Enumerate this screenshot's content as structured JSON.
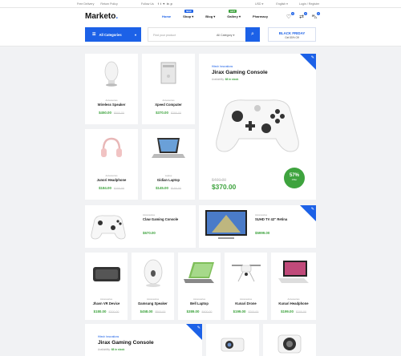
{
  "topbar": {
    "free_delivery": "Free Delivery",
    "return_policy": "Return Policy",
    "follow_us": "Follow Us",
    "social": [
      "f",
      "t",
      "✦",
      "in",
      "p"
    ],
    "currency": "USD ▾",
    "language": "English ▾",
    "login": "Login / Register"
  },
  "header": {
    "logo": "Marketo",
    "logo_dot": ".",
    "nav": [
      {
        "label": "Home",
        "active": true,
        "badge": ""
      },
      {
        "label": "Shop ▾",
        "active": false,
        "badge": "NEW",
        "badge_color": "#1c61e7"
      },
      {
        "label": "Blog ▾",
        "active": false,
        "badge": ""
      },
      {
        "label": "Gallery ▾",
        "active": false,
        "badge": "HOT",
        "badge_color": "#3ea33e"
      },
      {
        "label": "Pharmacy",
        "active": false,
        "badge": ""
      }
    ],
    "icons": [
      {
        "name": "wishlist-icon",
        "glyph": "♡",
        "count": "0"
      },
      {
        "name": "compare-icon",
        "glyph": "⇄",
        "count": "0"
      },
      {
        "name": "cart-icon",
        "glyph": "⛍",
        "count": "0"
      }
    ]
  },
  "search": {
    "all_categories": "All Categories",
    "placeholder": "Find your product",
    "category": "All Category ▾",
    "promo_title": "BLACK FRIDAY",
    "promo_sub": "Get 55% Off"
  },
  "products_small": [
    {
      "cat": "Accessories",
      "name": "Wireless Speaker",
      "price": "$450.00",
      "old": "$500.00",
      "icon": "speaker-icon"
    },
    {
      "cat": "Accessories",
      "name": "Xpeed Computer",
      "price": "$370.00",
      "old": "$390.00",
      "icon": "computer-icon"
    },
    {
      "cat": "Accessories",
      "name": "Junori Headphone",
      "price": "$184.00",
      "old": "$200.00",
      "icon": "headphone-icon"
    },
    {
      "cat": "Laptop",
      "name": "Gidian Laptop",
      "price": "$145.00",
      "old": "$150.00",
      "icon": "laptop-icon"
    }
  ],
  "featured": {
    "cat": "Hitech Innovations",
    "title": "Jirax Gaming Console",
    "availability_label": "Availability:",
    "availability": "68 in stock",
    "old_price": "$400.00",
    "price": "$370.00",
    "discount": "57%",
    "discount_label": "Offer",
    "corner": "✎"
  },
  "row2": [
    {
      "cat": "Accessories",
      "name": "Claw Gaming Console",
      "price": "$670.00",
      "old": "",
      "icon": "gamepad-icon"
    },
    {
      "cat": "Accessories",
      "name": "SUHD TV 42\" Retina",
      "price": "$5999.00",
      "old": "",
      "icon": "tv-icon"
    }
  ],
  "row3": [
    {
      "cat": "Accessories",
      "name": "Jhavn VR Device",
      "price": "$180.00",
      "old": "$200.00",
      "icon": "vr-icon"
    },
    {
      "cat": "Accessories",
      "name": "Damsung Speaker",
      "price": "$458.00",
      "old": "$500.00",
      "icon": "speaker-icon"
    },
    {
      "cat": "Accessories",
      "name": "Bell Laptop",
      "price": "$389.00",
      "old": "$400.00",
      "icon": "laptop-icon"
    },
    {
      "cat": "Accessories",
      "name": "Kunari Drone",
      "price": "$199.00",
      "old": "$200.00",
      "icon": "drone-icon"
    },
    {
      "cat": "Accessories",
      "name": "Kunari Headphone",
      "price": "$199.00",
      "old": "$200.00",
      "icon": "tablet-icon"
    }
  ],
  "featured2": {
    "cat": "Hitech Innovations",
    "title": "Jirax Gaming Console",
    "availability_label": "Availability:",
    "availability": "68 in stock"
  },
  "colors": {
    "accent": "#1c61e7",
    "green": "#3ea33e"
  }
}
